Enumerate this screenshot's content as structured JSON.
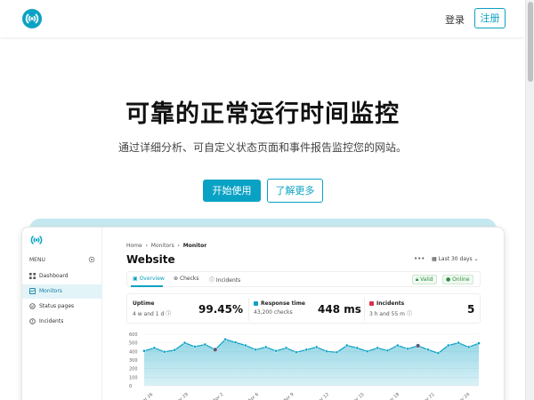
{
  "header": {
    "login": "登录",
    "register": "注册"
  },
  "hero": {
    "title": "可靠的正常运行时间监控",
    "subtitle": "通过详细分析、可自定义状态页面和事件报告监控您的网站。",
    "primary_button": "开始使用",
    "secondary_button": "了解更多"
  },
  "colors": {
    "accent": "#0aa2c4",
    "online": "#2e8b3e",
    "incident": "#d9304a"
  },
  "preview": {
    "menu_label": "MENU",
    "nav": [
      {
        "label": "Dashboard",
        "icon": "grid-icon"
      },
      {
        "label": "Monitors",
        "icon": "monitor-icon",
        "active": true
      },
      {
        "label": "Status pages",
        "icon": "status-icon"
      },
      {
        "label": "Incidents",
        "icon": "alert-icon"
      }
    ],
    "breadcrumb": [
      "Home",
      "Monitors",
      "Monitor"
    ],
    "title": "Website",
    "range": "Last 30 days",
    "tabs": [
      "Overview",
      "Checks",
      "Incidents"
    ],
    "badges": {
      "valid": "Valid",
      "online": "Online"
    },
    "stats": {
      "uptime": {
        "label": "Uptime",
        "sub": "4 w and 1 d",
        "value": "99.45%"
      },
      "response": {
        "label": "Response time",
        "sub": "43,200 checks",
        "value": "448 ms"
      },
      "incidents": {
        "label": "Incidents",
        "sub": "3 h and 55 m",
        "value": "5"
      }
    }
  },
  "chart_data": {
    "type": "area",
    "ylabel": "",
    "y_ticks": [
      "600",
      "500",
      "400",
      "300",
      "200",
      "100",
      "0"
    ],
    "ylim": [
      0,
      600
    ],
    "x_labels": [
      "Mar 26",
      "Mar 29",
      "Apr 2",
      "Apr 6",
      "Apr 9",
      "Apr 12",
      "Apr 15",
      "Apr 18",
      "Apr 21",
      "Apr 24"
    ],
    "values": [
      405,
      440,
      395,
      415,
      500,
      455,
      480,
      420,
      540,
      505,
      470,
      420,
      450,
      405,
      440,
      390,
      420,
      450,
      400,
      390,
      470,
      440,
      400,
      440,
      410,
      470,
      430,
      465,
      420,
      380,
      470,
      500,
      450,
      495
    ],
    "incident_points": [
      7,
      27
    ]
  }
}
